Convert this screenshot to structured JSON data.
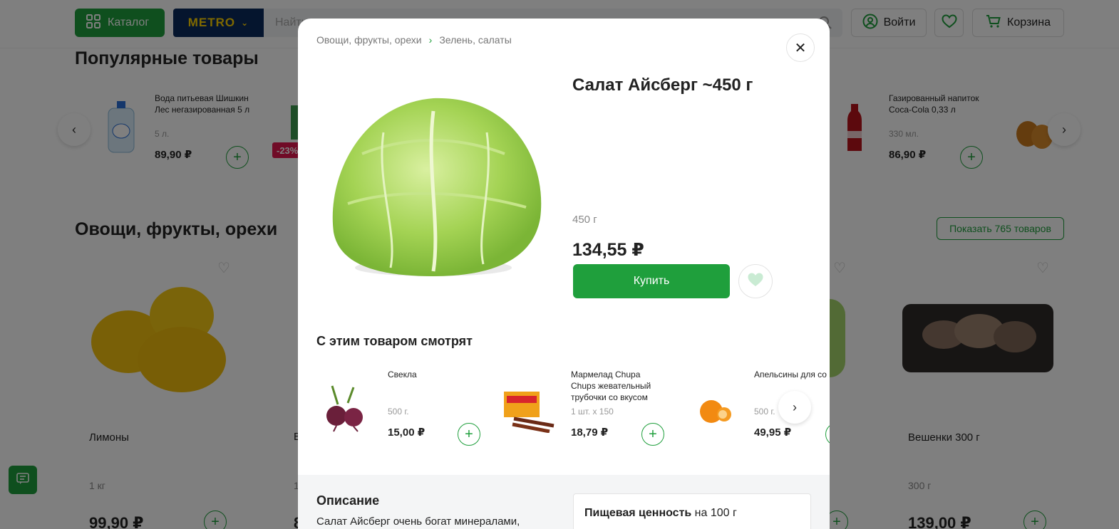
{
  "header": {
    "catalog_label": "Каталог",
    "logo_text": "METRO",
    "search_placeholder": "Найти",
    "login_label": "Войти",
    "cart_label": "Корзина"
  },
  "popular": {
    "title": "Популярные товары",
    "items": [
      {
        "name": "Вода питьевая Шишкин Лес негазированная 5 л",
        "weight": "5 л.",
        "price": "89,90 ₽"
      },
      {
        "badge": "-23%"
      },
      {
        "name": "Газированный напиток Coca-Cola 0,33 л",
        "weight": "330 мл.",
        "price": "86,90 ₽"
      }
    ]
  },
  "vegetables": {
    "title": "Овощи, фрукты, орехи",
    "show_all": "Показать 765 товаров",
    "cards": [
      {
        "name": "Лимоны",
        "weight": "1 кг",
        "price": "99,90 ₽"
      },
      {
        "name": "Вешенки 300 г",
        "weight": "300 г",
        "price": "139,00 ₽"
      }
    ],
    "partial_letters": [
      "В",
      "1",
      "8"
    ]
  },
  "modal": {
    "breadcrumb": [
      "Овощи, фрукты, орехи",
      "Зелень, салаты"
    ],
    "title": "Салат Айсберг ~450 г",
    "weight": "450 г",
    "price": "134,55 ₽",
    "buy_label": "Купить",
    "related_title": "С этим товаром смотрят",
    "related": [
      {
        "name": "Свекла",
        "weight": "500 г.",
        "price": "15,00 ₽"
      },
      {
        "name": "Мармелад Chupa Chups жевательный трубочки со вкусом",
        "weight": "1 шт. x 150",
        "price": "18,79 ₽"
      },
      {
        "name": "Апельсины для со",
        "weight": "500 г.",
        "price": "49,95 ₽"
      }
    ],
    "description_title": "Описание",
    "description_text": "Салат Айсберг очень богат минералами,",
    "nutrition_bold": "Пищевая ценность",
    "nutrition_rest": " на 100 г"
  },
  "colors": {
    "brand_green": "#1f9f3c",
    "metro_blue": "#0a2a5c",
    "metro_yellow": "#ffd200",
    "discount_red": "#e0174f"
  }
}
